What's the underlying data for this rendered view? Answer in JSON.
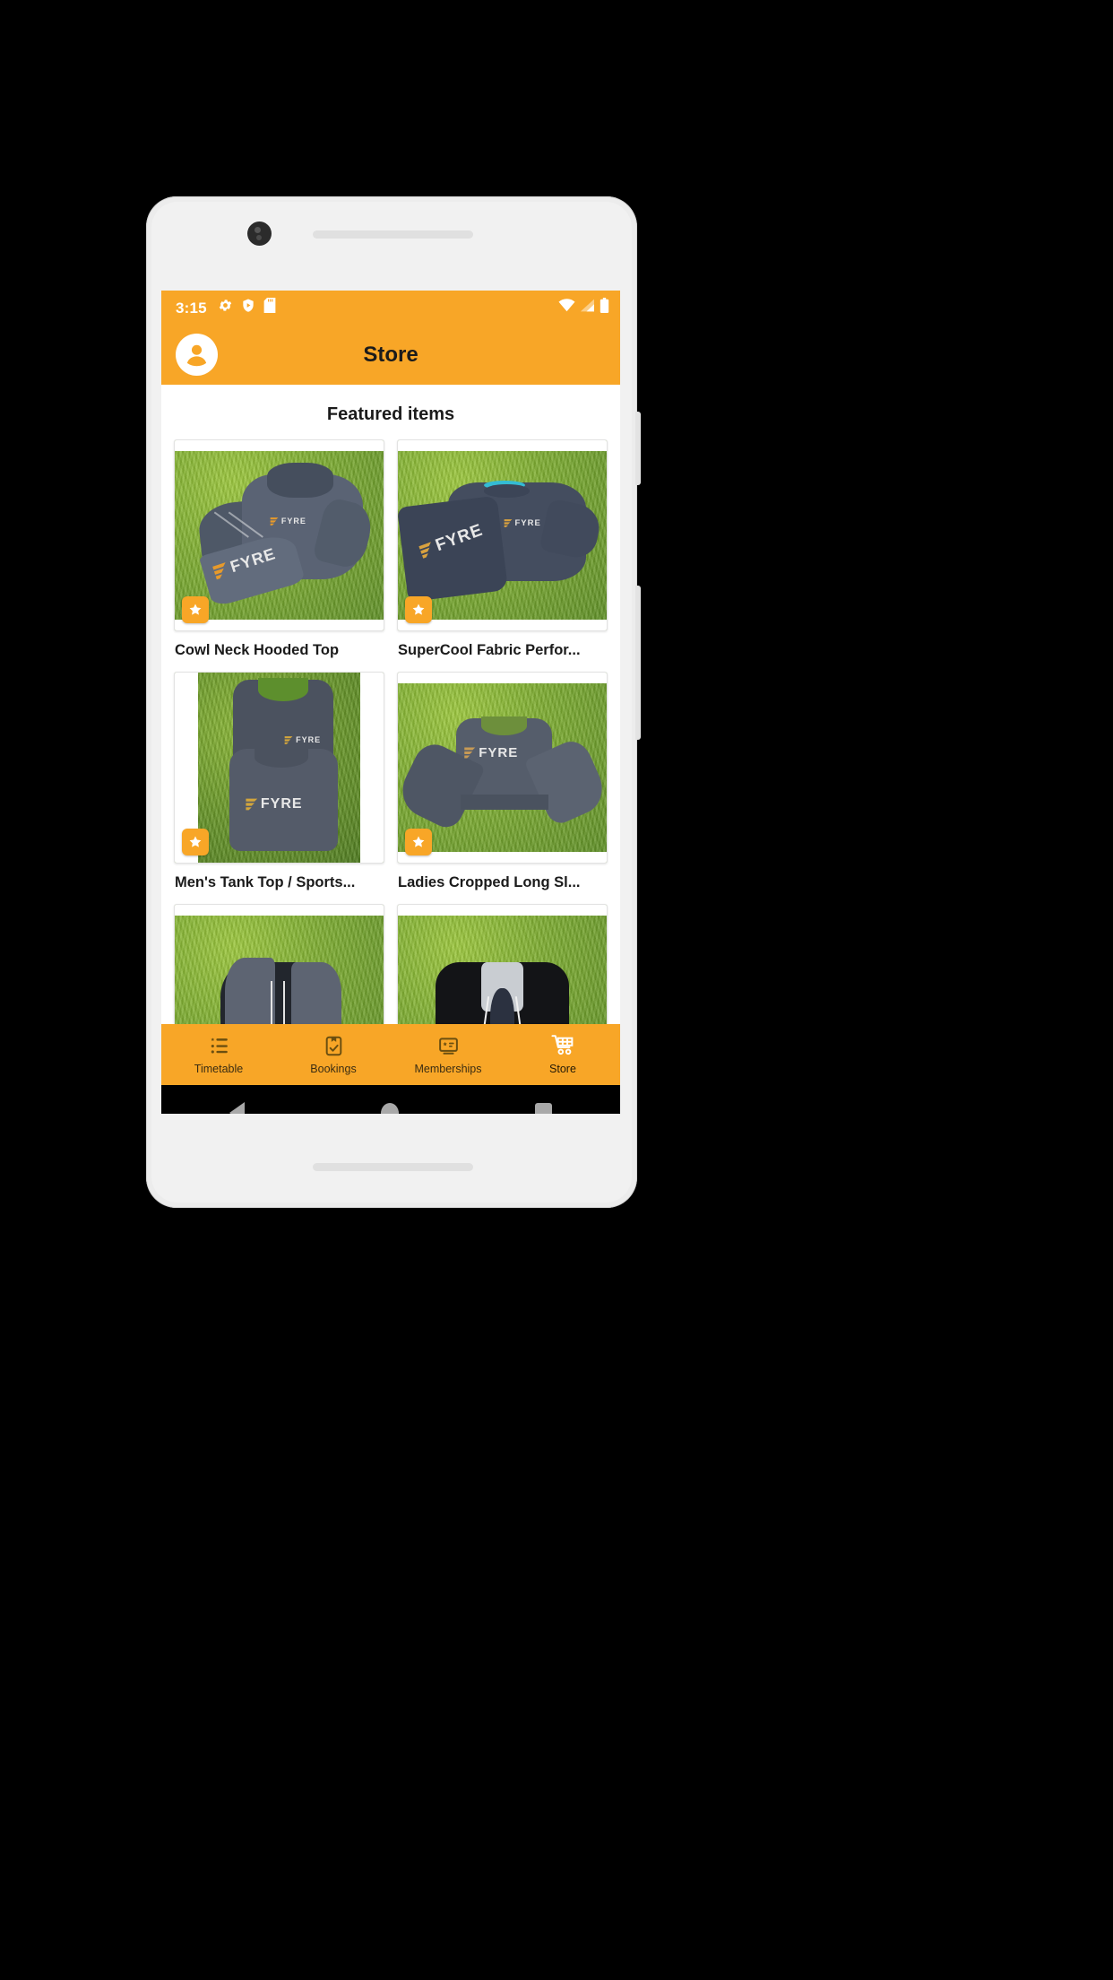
{
  "status_bar": {
    "time": "3:15",
    "left_icons": [
      "gear-icon",
      "shield-play-icon",
      "sd-card-icon"
    ],
    "right_icons": [
      "wifi-icon",
      "cell-signal-icon",
      "battery-icon"
    ],
    "background_color": "#f8a627",
    "foreground_color": "#ffffff"
  },
  "app_bar": {
    "title": "Store",
    "avatar_icon": "account-circle-icon",
    "background_color": "#f8a627",
    "title_color": "#1b1b1b"
  },
  "content": {
    "section_heading": "Featured items",
    "brand_wordmark": "FYRE",
    "products": [
      {
        "title": "Cowl Neck Hooded Top",
        "featured": true,
        "badge_icon": "star-icon",
        "photo": "grey-cowl-neck-hooded-top-on-grass"
      },
      {
        "title": "SuperCool Fabric Perfor...",
        "featured": true,
        "badge_icon": "star-icon",
        "photo": "navy-supercool-tshirt-pair-on-grass"
      },
      {
        "title": "Men's Tank Top / Sports...",
        "featured": true,
        "badge_icon": "star-icon",
        "photo": "grey-tank-tops-pair-on-grass"
      },
      {
        "title": "Ladies Cropped Long Sl...",
        "featured": true,
        "badge_icon": "star-icon",
        "photo": "grey-cropped-long-sleeve-top-on-grass"
      },
      {
        "title": "",
        "featured": false,
        "badge_icon": "",
        "photo": "camo-hoodie-on-grass"
      },
      {
        "title": "",
        "featured": false,
        "badge_icon": "",
        "photo": "black-hoodie-on-grass"
      }
    ]
  },
  "bottom_nav": {
    "background_color": "#f8a627",
    "active_index": 3,
    "items": [
      {
        "label": "Timetable",
        "icon": "list-star-icon"
      },
      {
        "label": "Bookings",
        "icon": "clipboard-check-icon"
      },
      {
        "label": "Memberships",
        "icon": "membership-card-icon"
      },
      {
        "label": "Store",
        "icon": "shopping-cart-icon"
      }
    ]
  },
  "system_nav": {
    "back": "back-triangle-icon",
    "home": "home-circle-icon",
    "recents": "recents-square-icon"
  }
}
